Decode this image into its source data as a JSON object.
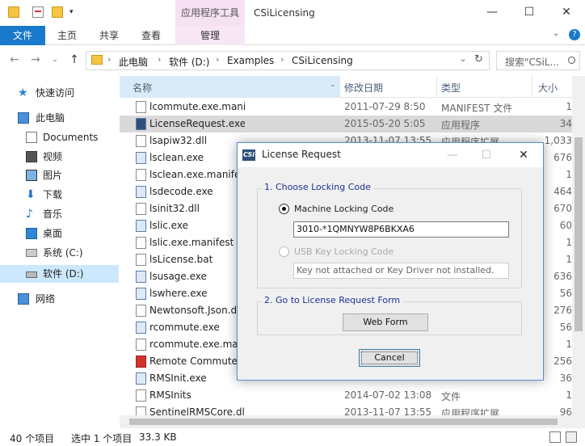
{
  "window": {
    "title": "CSiLicensing",
    "context_tab": "应用程序工具",
    "min_icon": "minimize-icon",
    "max_icon": "maximize-icon",
    "close_icon": "close-icon"
  },
  "ribbon": {
    "tabs": [
      "文件",
      "主页",
      "共享",
      "查看"
    ],
    "context_subtab": "管理"
  },
  "address": {
    "crumbs": [
      "此电脑",
      "软件 (D:)",
      "Examples",
      "CSiLicensing"
    ],
    "search_placeholder": "搜索\"CSiL..."
  },
  "nav": {
    "items": [
      {
        "label": "快速访问",
        "icon": "star-icon"
      },
      {
        "label": "此电脑",
        "icon": "computer-icon"
      },
      {
        "label": "Documents",
        "icon": "documents-icon"
      },
      {
        "label": "视频",
        "icon": "video-icon"
      },
      {
        "label": "图片",
        "icon": "pictures-icon"
      },
      {
        "label": "下载",
        "icon": "download-icon"
      },
      {
        "label": "音乐",
        "icon": "music-icon"
      },
      {
        "label": "桌面",
        "icon": "desktop-icon"
      },
      {
        "label": "系统 (C:)",
        "icon": "drive-icon"
      },
      {
        "label": "软件 (D:)",
        "icon": "drive-icon"
      },
      {
        "label": "网络",
        "icon": "network-icon"
      }
    ]
  },
  "columns": {
    "name": "名称",
    "date": "修改日期",
    "type": "类型",
    "size": "大小"
  },
  "files": [
    {
      "name": "lcommute.exe.manifest",
      "date": "2011-07-29 8:50",
      "type": "MANIFEST 文件",
      "size": "1"
    },
    {
      "name": "LicenseRequest.exe",
      "date": "2015-05-20 5:05",
      "type": "应用程序",
      "size": "34"
    },
    {
      "name": "lsapiw32.dll",
      "date": "2013-11-07 13:55",
      "type": "应用程序扩展",
      "size": "1,033"
    },
    {
      "name": "lsclean.exe",
      "date": "",
      "type": "",
      "size": "676"
    },
    {
      "name": "lsclean.exe.manifest",
      "date": "",
      "type": "",
      "size": "1"
    },
    {
      "name": "lsdecode.exe",
      "date": "",
      "type": "",
      "size": "464"
    },
    {
      "name": "lsinit32.dll",
      "date": "",
      "type": "",
      "size": "670"
    },
    {
      "name": "lslic.exe",
      "date": "",
      "type": "",
      "size": "60"
    },
    {
      "name": "lslic.exe.manifest",
      "date": "",
      "type": "",
      "size": "1"
    },
    {
      "name": "lsLicense.bat",
      "date": "",
      "type": "",
      "size": "1"
    },
    {
      "name": "lsusage.exe",
      "date": "",
      "type": "",
      "size": "636"
    },
    {
      "name": "lswhere.exe",
      "date": "",
      "type": "",
      "size": "56"
    },
    {
      "name": "Newtonsoft.Json.dll",
      "date": "",
      "type": "",
      "size": "276"
    },
    {
      "name": "rcommute.exe",
      "date": "",
      "type": "",
      "size": "56"
    },
    {
      "name": "rcommute.exe.manifest",
      "date": "",
      "type": "",
      "size": "1"
    },
    {
      "name": "Remote Commuter",
      "date": "",
      "type": "",
      "size": "256"
    },
    {
      "name": "RMSInit.exe",
      "date": "",
      "type": "",
      "size": "36"
    },
    {
      "name": "RMSInits",
      "date": "2014-07-02 13:08",
      "type": "文件",
      "size": "1"
    },
    {
      "name": "SentinelRMSCore.dll",
      "date": "2013-11-07 13:55",
      "type": "应用程序扩展",
      "size": "96"
    }
  ],
  "status": {
    "count": "40 个项目",
    "selected": "选中 1 个项目",
    "size": "33.3 KB"
  },
  "dialog": {
    "title": "License Request",
    "group1_title": "1.  Choose Locking Code",
    "option_machine": "Machine Locking Code",
    "machine_code": "3010-*1QMNYW8P6BKXA6",
    "option_usb": "USB Key Locking Code",
    "usb_status": "Key not attached or Key Driver not installed.",
    "group2_title": "2.  Go to License Request Form",
    "webform_label": "Web Form",
    "cancel_label": "Cancel"
  }
}
